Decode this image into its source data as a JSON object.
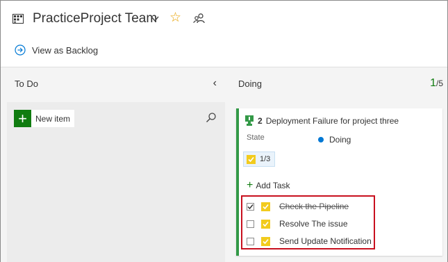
{
  "header": {
    "team_name": "PracticeProject Team",
    "view_backlog_label": "View as Backlog"
  },
  "columns": {
    "todo": {
      "title": "To Do",
      "new_item_label": "New item"
    },
    "doing": {
      "title": "Doing",
      "wip_count": "1",
      "wip_limit": "/5"
    }
  },
  "card": {
    "id": "2",
    "title": "Deployment Failure for project three",
    "state_label": "State",
    "state_value": "Doing",
    "progress": "1/3",
    "add_task_label": "Add Task",
    "tasks": [
      {
        "label": "Check the Pipeline",
        "done": true
      },
      {
        "label": "Resolve The issue",
        "done": false
      },
      {
        "label": "Send Update Notification",
        "done": false
      }
    ]
  },
  "colors": {
    "accent_green": "#107c10",
    "card_border": "#339947",
    "state_dot": "#0078d4",
    "task_yellow": "#f2cb1d",
    "highlight_red": "#c8101e",
    "star": "#e8a100"
  }
}
